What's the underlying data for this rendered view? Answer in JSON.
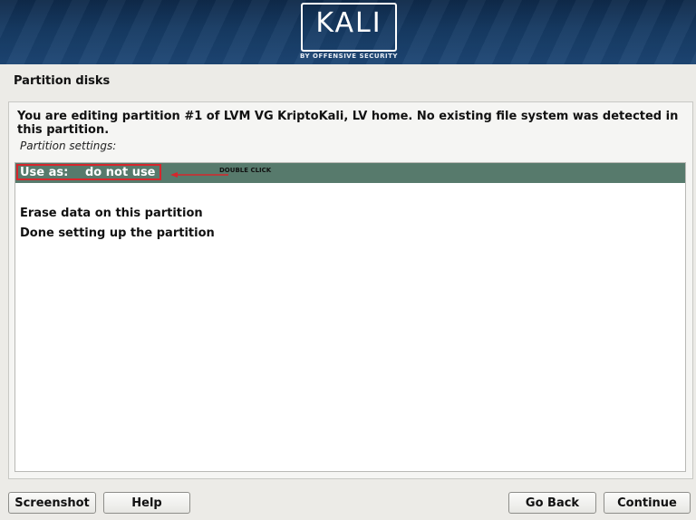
{
  "header": {
    "logo_text": "KALI",
    "logo_subtitle": "BY OFFENSIVE SECURITY"
  },
  "step": {
    "title": "Partition disks"
  },
  "main": {
    "description": "You are editing partition #1 of LVM VG KriptoKali, LV home. No existing file system was detected in this partition.",
    "settings_label": "Partition settings:",
    "items": [
      {
        "label": "Use as:",
        "value": "do not use",
        "selected": true
      },
      {
        "label": "Erase data on this partition"
      },
      {
        "label": "Done setting up the partition"
      }
    ]
  },
  "annotation": {
    "text": "DOUBLE CLICK",
    "color": "#d6262c"
  },
  "buttons": {
    "screenshot": "Screenshot",
    "help": "Help",
    "go_back": "Go Back",
    "continue": "Continue"
  },
  "colors": {
    "banner": "#163a63",
    "selection": "#577a6c"
  }
}
